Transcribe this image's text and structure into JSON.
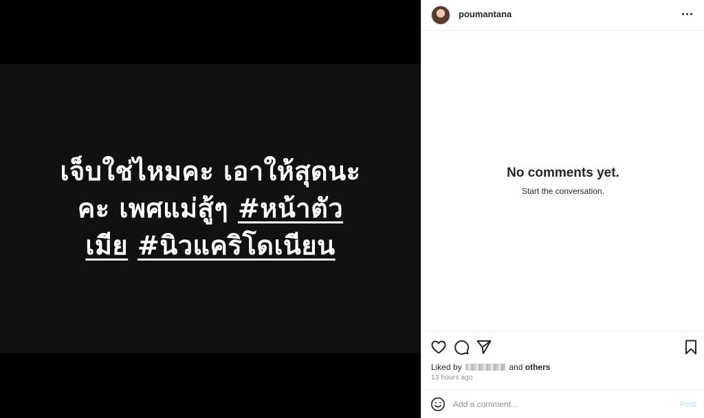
{
  "post": {
    "caption_lines": [
      [
        "เจ็บใช่ไหมคะ เอาให้สุดนะ"
      ],
      [
        "คะ เพศแม่สู้ๆ ",
        "#หน้าตัว"
      ],
      [
        "เมีย",
        " ",
        "#นิวแคริโดเนียน"
      ]
    ],
    "caption": {
      "line1": "เจ็บใช่ไหมคะ เอาให้สุดนะ",
      "line2_text": "คะ เพศแม่สู้ๆ ",
      "line2_tag": "#หน้าตัว",
      "line3_tag_a": "เมีย",
      "line3_space": " ",
      "line3_tag_b": "#นิวแคริโดเนียน"
    }
  },
  "header": {
    "username": "poumantana"
  },
  "comments": {
    "empty_title": "No comments yet.",
    "empty_subtitle": "Start the conversation."
  },
  "likes": {
    "prefix": "Liked by ",
    "conjunction": "and",
    "others": "others"
  },
  "time": "13 HOURS AGO",
  "time_display": "13 hours ago",
  "comment_box": {
    "placeholder": "Add a comment...",
    "post_label": "Post"
  },
  "icons": {
    "more": "more-options-icon",
    "like": "heart-icon",
    "comment": "comment-bubble-icon",
    "share": "paper-plane-icon",
    "save": "bookmark-icon",
    "emoji": "smiley-icon"
  },
  "colors": {
    "post_button_disabled": "#b2dffc",
    "muted_text": "#8e8e8e"
  }
}
